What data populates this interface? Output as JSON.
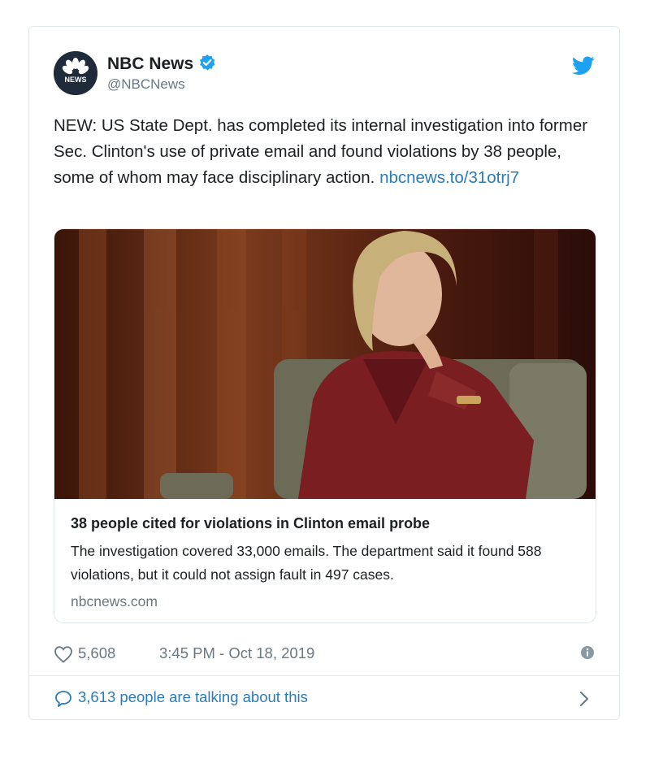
{
  "author": {
    "name": "NBC News",
    "handle": "@NBCNews",
    "avatar_text": "NEWS"
  },
  "tweet": {
    "text": "NEW: US State Dept. has completed its internal investigation into former Sec. Clinton's use of private email and found violations by 38 people, some of whom may face disciplinary action. ",
    "link": "nbcnews.to/31otrj7"
  },
  "card": {
    "title": "38 people cited for violations in Clinton email probe",
    "description": "The investigation covered 33,000 emails. The department said it found 588 violations, but it could not assign fault in 497 cases.",
    "domain": "nbcnews.com"
  },
  "meta": {
    "likes": "5,608",
    "timestamp": "3:45 PM - Oct 18, 2019"
  },
  "footer": {
    "talking": "3,613 people are talking about this"
  },
  "colors": {
    "link": "#2b7bb9",
    "verified": "#1da1f2",
    "muted": "#697882",
    "border": "#e1e8ed"
  },
  "icons": [
    "nbc-peacock-logo",
    "verified-badge-icon",
    "twitter-bird-icon",
    "heart-icon",
    "info-icon",
    "comment-icon",
    "chevron-right-icon"
  ]
}
